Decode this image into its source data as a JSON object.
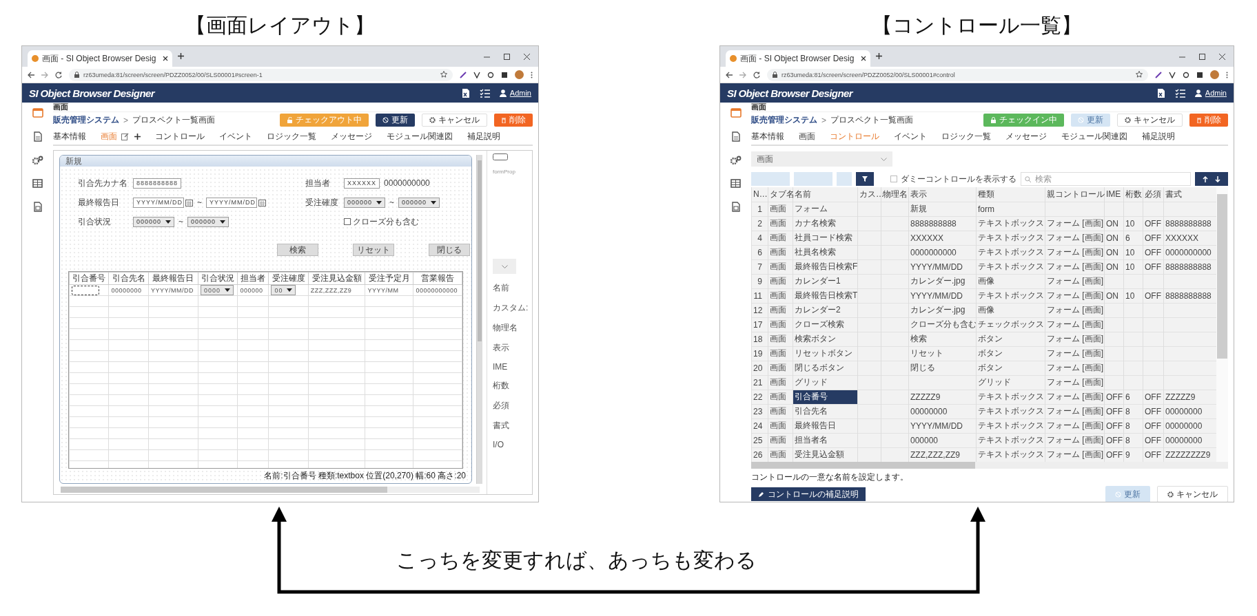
{
  "panels": [
    {
      "title": "【画面レイアウト】",
      "window": {
        "tab_title": "画面 - SI Object Browser Desig",
        "url": "rz63umeda:81/screen/screen/PDZZ0052/00/SLS00001#screen-1",
        "app_name": "SI Object Browser Designer",
        "user": "Admin",
        "sidebar": [
          {
            "kind": "window",
            "selected": true
          },
          {
            "kind": "document",
            "selected": false
          },
          {
            "kind": "gears",
            "selected": false
          },
          {
            "kind": "table",
            "selected": false
          },
          {
            "kind": "report",
            "selected": false
          }
        ],
        "heading": "画面",
        "breadcrumb": [
          "販売管理システム",
          "プロスペクト一覧画面"
        ],
        "breadcrumb_separator": ">",
        "actions": [
          {
            "kind": "checkout",
            "label": "チェックアウト中"
          },
          {
            "kind": "primary",
            "label": "更新"
          },
          {
            "kind": "default",
            "label": "キャンセル"
          },
          {
            "kind": "danger",
            "label": "削除"
          }
        ],
        "tab_tools": true,
        "tabs": [
          {
            "label": "基本情報",
            "selected": false
          },
          {
            "label": "画面",
            "selected": true
          },
          {
            "label": "コントロール",
            "selected": false
          },
          {
            "label": "イベント",
            "selected": false
          },
          {
            "label": "ロジック一覧",
            "selected": false
          },
          {
            "label": "メッセージ",
            "selected": false
          },
          {
            "label": "モジュール関連図",
            "selected": false
          },
          {
            "label": "補足説明",
            "selected": false
          }
        ],
        "kind": "layout",
        "designer": {
          "form_title": "新規",
          "fields": [
            {
              "left_label": "引合先カナ名",
              "left": [
                {
                  "kind": "textbox",
                  "value": "8888888888"
                }
              ],
              "right_label": "担当者",
              "right": [
                {
                  "kind": "textbox",
                  "value": "XXXXXX"
                },
                {
                  "kind": "text",
                  "text": "0000000000"
                }
              ]
            },
            {
              "left_label": "最終報告日",
              "left": [
                {
                  "kind": "date",
                  "value": "YYYY/MM/DD"
                },
                {
                  "kind": "text",
                  "text": "~"
                },
                {
                  "kind": "date",
                  "value": "YYYY/MM/DD"
                }
              ],
              "right_label": "受注確度",
              "right": [
                {
                  "kind": "select",
                  "value": "000000"
                },
                {
                  "kind": "text",
                  "text": "~"
                },
                {
                  "kind": "select",
                  "value": "000000"
                }
              ]
            },
            {
              "left_label": "引合状況",
              "left": [
                {
                  "kind": "select",
                  "value": "000000"
                },
                {
                  "kind": "text",
                  "text": "~"
                },
                {
                  "kind": "select",
                  "value": "000000"
                }
              ],
              "right": [
                {
                  "kind": "checkbox",
                  "label": "クローズ分も含む",
                  "checked": false
                }
              ]
            }
          ],
          "buttons": [
            "検索",
            "リセット",
            "閉じる"
          ],
          "grid": {
            "columns": [
              "引合番号",
              "引合先名",
              "最終報告日",
              "引合状況",
              "担当者",
              "受注確度",
              "受注見込金額",
              "受注予定月",
              "営業報告"
            ],
            "cells": [
              {
                "kind": "selected"
              },
              {
                "kind": "text",
                "value": "00000000"
              },
              {
                "kind": "text",
                "value": "YYYY/MM/DD"
              },
              {
                "kind": "select",
                "value": "0000"
              },
              {
                "kind": "text",
                "value": "000000"
              },
              {
                "kind": "select",
                "value": "00"
              },
              {
                "kind": "text",
                "value": "ZZZ,ZZZ,ZZ9"
              },
              {
                "kind": "text",
                "value": "YYYY/MM"
              },
              {
                "kind": "text",
                "value": "00000000000"
              }
            ]
          },
          "status": "名前:引合番号 種類:textbox 位置(20,270) 幅:60 高さ:20",
          "props": {
            "panel_label": "formProp",
            "labels": [
              "名前",
              "カスタム:",
              "物理名",
              "表示",
              "IME",
              "桁数",
              "必須",
              "書式",
              "I/O"
            ]
          }
        }
      }
    },
    {
      "title": "【コントロール一覧】",
      "window": {
        "tab_title": "画面 - SI Object Browser Desig",
        "url": "rz63umeda:81/screen/screen/PDZZ0052/00/SLS00001#control",
        "app_name": "SI Object Browser Designer",
        "user": "Admin",
        "sidebar": [
          {
            "kind": "window",
            "selected": true
          },
          {
            "kind": "document",
            "selected": false
          },
          {
            "kind": "gears",
            "selected": false
          },
          {
            "kind": "table",
            "selected": false
          },
          {
            "kind": "report",
            "selected": false
          }
        ],
        "heading": "画面",
        "breadcrumb": [
          "販売管理システム",
          "プロスペクト一覧画面"
        ],
        "breadcrumb_separator": ">",
        "actions": [
          {
            "kind": "checkin",
            "label": "チェックイン中"
          },
          {
            "kind": "disabled",
            "label": "更新"
          },
          {
            "kind": "default",
            "label": "キャンセル"
          },
          {
            "kind": "danger",
            "label": "削除"
          }
        ],
        "tab_tools": false,
        "tabs": [
          {
            "label": "基本情報",
            "selected": false
          },
          {
            "label": "画面",
            "selected": false
          },
          {
            "label": "コントロール",
            "selected": true
          },
          {
            "label": "イベント",
            "selected": false
          },
          {
            "label": "ロジック一覧",
            "selected": false
          },
          {
            "label": "メッセージ",
            "selected": false
          },
          {
            "label": "モジュール関連図",
            "selected": false
          },
          {
            "label": "補足説明",
            "selected": false
          }
        ],
        "kind": "control_list",
        "control_list": {
          "screen_select": "画面",
          "dummy_checkbox": {
            "label": "ダミーコントロールを表示する",
            "checked": false
          },
          "search_placeholder": "検索",
          "columns": [
            "N…",
            "タブ名",
            "名前",
            "カス…",
            "物理名",
            "表示",
            "種類",
            "親コントロール",
            "IME",
            "桁数",
            "必須",
            "書式"
          ],
          "rows": [
            {
              "no": "1",
              "tab": "画面",
              "name": "フォーム",
              "display": "新規",
              "type": "form",
              "selected": false
            },
            {
              "no": "2",
              "tab": "画面",
              "name": "カナ名検索",
              "display": "8888888888",
              "type": "テキストボックス",
              "parent": "フォーム [画面]",
              "ime": "ON",
              "digits": "10",
              "required": "OFF",
              "format": "8888888888",
              "selected": false
            },
            {
              "no": "4",
              "tab": "画面",
              "name": "社員コード検索",
              "display": "XXXXXX",
              "type": "テキストボックス",
              "parent": "フォーム [画面]",
              "ime": "ON",
              "digits": "6",
              "required": "OFF",
              "format": "XXXXXX",
              "selected": false
            },
            {
              "no": "6",
              "tab": "画面",
              "name": "社員名検索",
              "display": "0000000000",
              "type": "テキストボックス",
              "parent": "フォーム [画面]",
              "ime": "ON",
              "digits": "10",
              "required": "OFF",
              "format": "0000000000",
              "selected": false
            },
            {
              "no": "7",
              "tab": "画面",
              "name": "最終報告日検索F",
              "display": "YYYY/MM/DD",
              "type": "テキストボックス",
              "parent": "フォーム [画面]",
              "ime": "ON",
              "digits": "10",
              "required": "OFF",
              "format": "8888888888",
              "selected": false
            },
            {
              "no": "9",
              "tab": "画面",
              "name": "カレンダー1",
              "display": "カレンダー.jpg",
              "type": "画像",
              "parent": "フォーム [画面]",
              "selected": false
            },
            {
              "no": "11",
              "tab": "画面",
              "name": "最終報告日検索T",
              "display": "YYYY/MM/DD",
              "type": "テキストボックス",
              "parent": "フォーム [画面]",
              "ime": "ON",
              "digits": "10",
              "required": "OFF",
              "format": "8888888888",
              "selected": false
            },
            {
              "no": "12",
              "tab": "画面",
              "name": "カレンダー2",
              "display": "カレンダー.jpg",
              "type": "画像",
              "parent": "フォーム [画面]",
              "selected": false
            },
            {
              "no": "17",
              "tab": "画面",
              "name": "クローズ検索",
              "display": "クローズ分も含む",
              "type": "チェックボックス",
              "parent": "フォーム [画面]",
              "selected": false
            },
            {
              "no": "18",
              "tab": "画面",
              "name": "検索ボタン",
              "display": "検索",
              "type": "ボタン",
              "parent": "フォーム [画面]",
              "selected": false
            },
            {
              "no": "19",
              "tab": "画面",
              "name": "リセットボタン",
              "display": "リセット",
              "type": "ボタン",
              "parent": "フォーム [画面]",
              "selected": false
            },
            {
              "no": "20",
              "tab": "画面",
              "name": "閉じるボタン",
              "display": "閉じる",
              "type": "ボタン",
              "parent": "フォーム [画面]",
              "selected": false
            },
            {
              "no": "21",
              "tab": "画面",
              "name": "グリッド",
              "type": "グリッド",
              "parent": "フォーム [画面]",
              "selected": false
            },
            {
              "no": "22",
              "tab": "画面",
              "name": "引合番号",
              "display": "ZZZZZ9",
              "type": "テキストボックス",
              "parent": "フォーム [画面]",
              "ime": "OFF",
              "digits": "6",
              "required": "OFF",
              "format": "ZZZZZ9",
              "selected": true
            },
            {
              "no": "23",
              "tab": "画面",
              "name": "引合先名",
              "display": "00000000",
              "type": "テキストボックス",
              "parent": "フォーム [画面]",
              "ime": "OFF",
              "digits": "8",
              "required": "OFF",
              "format": "00000000",
              "selected": false
            },
            {
              "no": "24",
              "tab": "画面",
              "name": "最終報告日",
              "display": "YYYY/MM/DD",
              "type": "テキストボックス",
              "parent": "フォーム [画面]",
              "ime": "OFF",
              "digits": "8",
              "required": "OFF",
              "format": "00000000",
              "selected": false
            },
            {
              "no": "25",
              "tab": "画面",
              "name": "担当者名",
              "display": "000000",
              "type": "テキストボックス",
              "parent": "フォーム [画面]",
              "ime": "OFF",
              "digits": "8",
              "required": "OFF",
              "format": "00000000",
              "selected": false
            },
            {
              "no": "26",
              "tab": "画面",
              "name": "受注見込金額",
              "display": "ZZZ,ZZZ,ZZ9",
              "type": "テキストボックス",
              "parent": "フォーム [画面]",
              "ime": "OFF",
              "digits": "9",
              "required": "OFF",
              "format": "ZZZZZZZZ9",
              "selected": false
            }
          ],
          "hint": "コントロールの一意な名前を設定します。",
          "note_button": "コントロールの補足説明",
          "footer_buttons": [
            {
              "kind": "disabled",
              "label": "更新"
            },
            {
              "kind": "default",
              "label": "キャンセル"
            }
          ]
        }
      }
    }
  ],
  "caption": "こっちを変更すれば、あっちも変わる"
}
